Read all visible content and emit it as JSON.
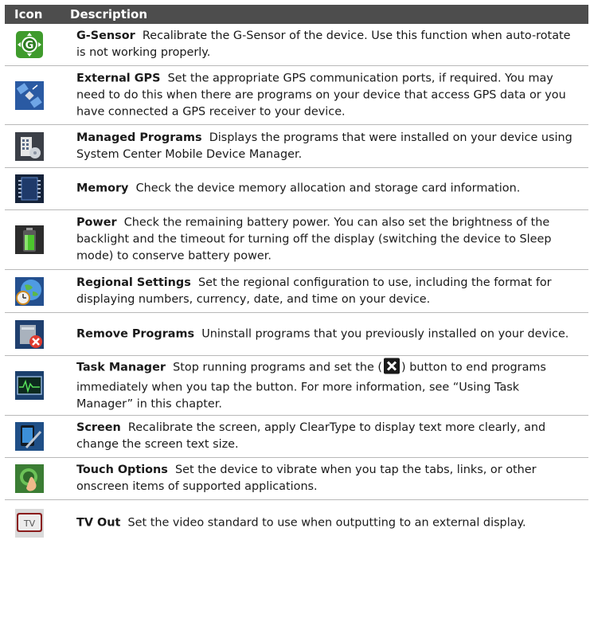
{
  "header": {
    "icon_col": "Icon",
    "desc_col": "Description"
  },
  "rows": [
    {
      "icon": "g-sensor-icon",
      "title": "G-Sensor",
      "text": "Recalibrate the G-Sensor of the device. Use this function when auto-rotate is not working properly."
    },
    {
      "icon": "satellite-icon",
      "title": "External GPS",
      "text": "Set the appropriate GPS communication ports, if required. You may need to do this when there are programs on your device that access GPS data or you have connected a GPS receiver to your device."
    },
    {
      "icon": "managed-programs-icon",
      "title": "Managed Programs",
      "text": "Displays the programs that were installed on your device using System Center Mobile Device Manager."
    },
    {
      "icon": "memory-chip-icon",
      "title": "Memory",
      "text": "Check the device memory allocation and storage card information."
    },
    {
      "icon": "battery-icon",
      "title": "Power",
      "text": "Check the remaining battery power. You can also set the brightness of the backlight and the timeout for turning off the display (switching the device to Sleep mode) to conserve battery power."
    },
    {
      "icon": "globe-clock-icon",
      "title": "Regional Settings",
      "text": "Set the regional configuration to use, including the format for displaying numbers, currency, date, and time on your device."
    },
    {
      "icon": "remove-programs-icon",
      "title": "Remove Programs",
      "text": "Uninstall programs that you previously installed on your device."
    },
    {
      "icon": "task-manager-icon",
      "title": "Task Manager",
      "text_a": "Stop running programs and set the (",
      "text_b": ") button to end programs immediately when you tap the button. For more information, see “Using Task Manager” in this chapter."
    },
    {
      "icon": "screen-stylus-icon",
      "title": "Screen",
      "text": "Recalibrate the screen, apply ClearType to display text more clearly, and change the screen text size."
    },
    {
      "icon": "touch-options-icon",
      "title": "Touch Options",
      "text": "Set the device to vibrate when you tap the tabs, links, or other onscreen items of supported applications."
    },
    {
      "icon": "tv-icon",
      "title": "TV Out",
      "text": "Set the video standard to use when outputting to an external display."
    }
  ]
}
